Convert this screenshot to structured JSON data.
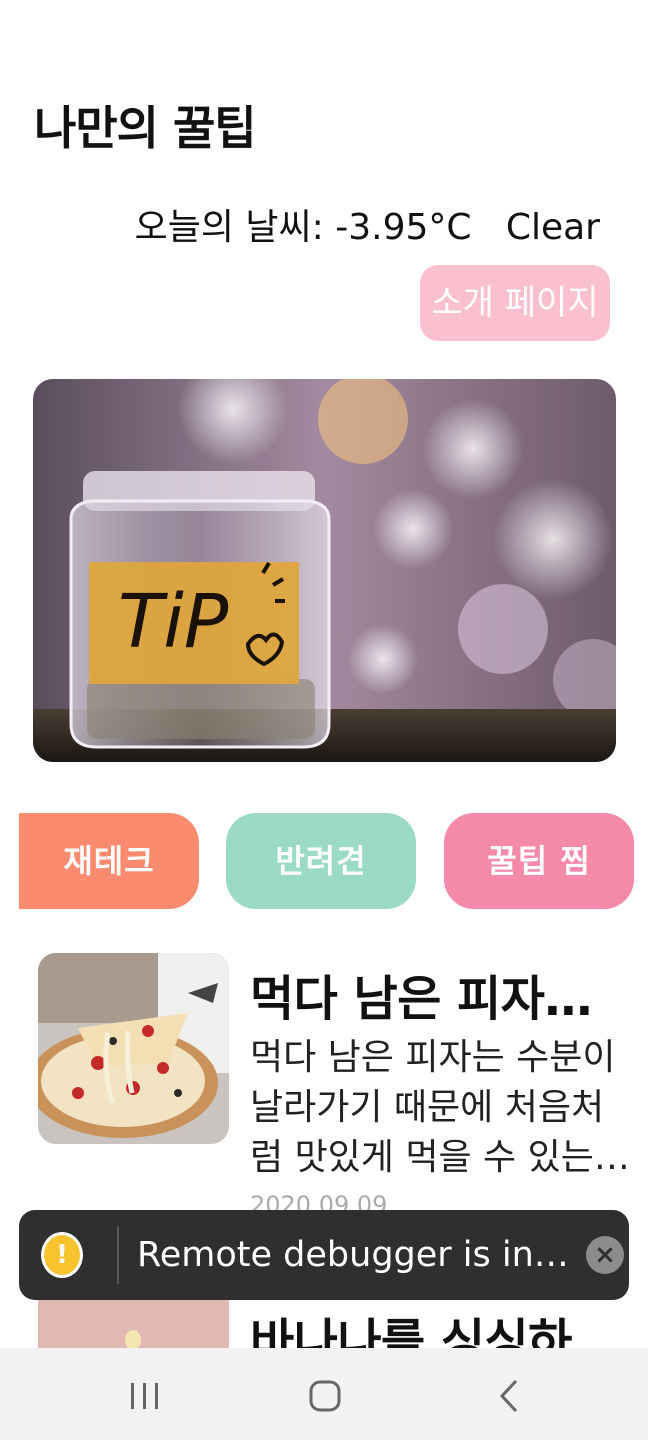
{
  "header": {
    "title": "나만의 꿀팁",
    "weather": "오늘의 날씨: -3.95°C   Clear",
    "about_button": "소개 페이지"
  },
  "hero": {
    "label_text": "TiP"
  },
  "categories": [
    {
      "label": "재테크",
      "color": "#fb8b6f"
    },
    {
      "label": "반려견",
      "color": "#9bdbc3"
    },
    {
      "label": "꿀팁 찜",
      "color": "#f589a9"
    }
  ],
  "posts": [
    {
      "title": "먹다 남은 피자를 가장 맛있게 먹는 방법",
      "body": "먹다 남은 피자는 수분이 날라가기 때문에 처음처럼 맛있게 먹을 수 있는 방법은...",
      "date": "2020.09.09"
    },
    {
      "title": "바나나를 싱싱하게 보관하는 방법"
    }
  ],
  "toast": {
    "text": "Remote debugger is in use"
  },
  "navbar": {
    "recent_icon": "recent-apps-icon",
    "home_icon": "home-icon",
    "back_icon": "back-icon"
  }
}
